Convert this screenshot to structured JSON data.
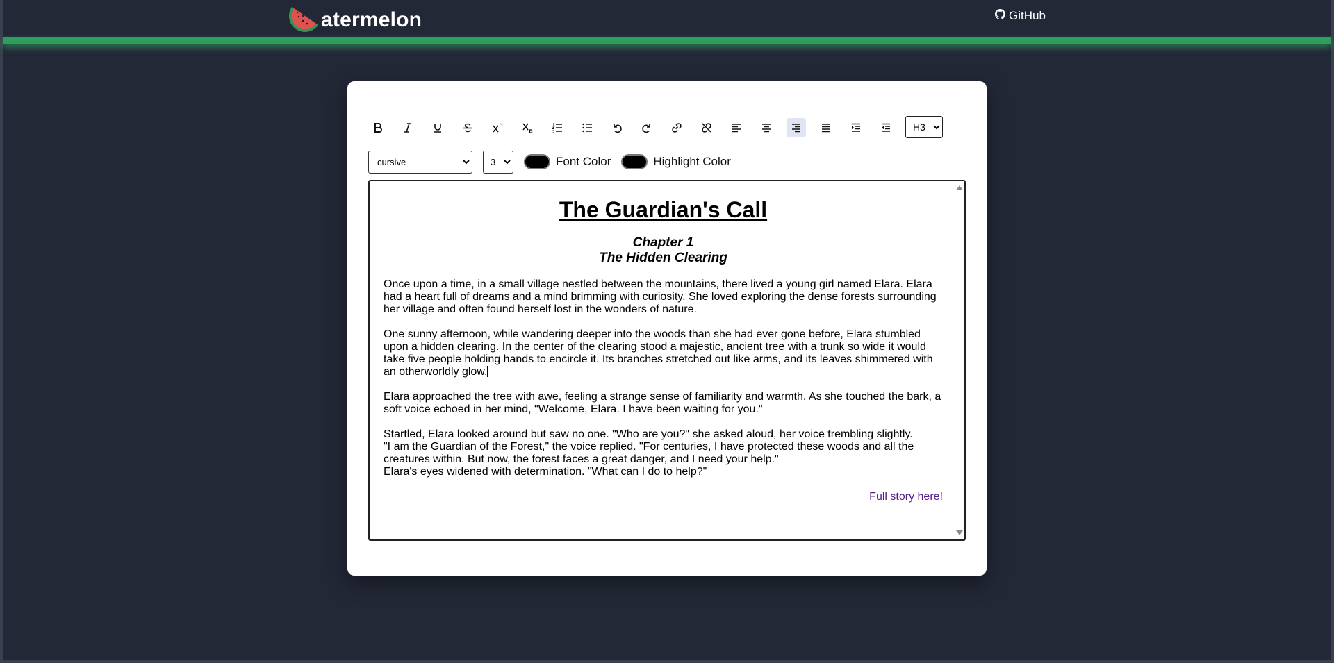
{
  "header": {
    "logo_text": "atermelon",
    "github_label": "GitHub"
  },
  "toolbar": {
    "buttons": [
      {
        "name": "bold-button",
        "icon": "bold-icon"
      },
      {
        "name": "italic-button",
        "icon": "italic-icon"
      },
      {
        "name": "underline-button",
        "icon": "underline-icon"
      },
      {
        "name": "strikethrough-button",
        "icon": "strikethrough-icon"
      },
      {
        "name": "superscript-button",
        "icon": "superscript-icon"
      },
      {
        "name": "subscript-button",
        "icon": "subscript-icon"
      },
      {
        "name": "ordered-list-button",
        "icon": "ordered-list-icon"
      },
      {
        "name": "unordered-list-button",
        "icon": "unordered-list-icon"
      },
      {
        "name": "undo-button",
        "icon": "undo-icon"
      },
      {
        "name": "redo-button",
        "icon": "redo-icon"
      },
      {
        "name": "link-button",
        "icon": "link-icon"
      },
      {
        "name": "unlink-button",
        "icon": "unlink-icon"
      },
      {
        "name": "align-left-button",
        "icon": "align-left-icon"
      },
      {
        "name": "align-center-button",
        "icon": "align-center-icon"
      },
      {
        "name": "align-right-button",
        "icon": "align-right-icon",
        "active": true
      },
      {
        "name": "align-justify-button",
        "icon": "align-justify-icon"
      },
      {
        "name": "indent-button",
        "icon": "indent-icon"
      },
      {
        "name": "outdent-button",
        "icon": "outdent-icon"
      }
    ],
    "heading_value": "H3",
    "font_family_value": "cursive",
    "font_size_value": "3",
    "font_color_label": "Font Color",
    "highlight_color_label": "Highlight Color",
    "font_color": "#000000",
    "highlight_color": "#000000"
  },
  "editor": {
    "title": "The Guardian's Call",
    "chapter_line1": "Chapter 1",
    "chapter_line2": "The Hidden Clearing",
    "para1": "Once upon a time, in a small village nestled between the mountains, there lived a young girl named Elara. Elara had a heart full of dreams and a mind brimming with curiosity. She loved exploring the dense forests surrounding her village and often found herself lost in the wonders of nature.",
    "para2": "One sunny afternoon, while wandering deeper into the woods than she had ever gone before, Elara stumbled upon a hidden clearing. In the center of the clearing stood a majestic, ancient tree with a trunk so wide it would take five people holding hands to encircle it. Its branches stretched out like arms, and its leaves shimmered with an otherworldly glow.",
    "para3": "Elara approached the tree with awe, feeling a strange sense of familiarity and warmth. As she touched the bark, a soft voice echoed in her mind, \"Welcome, Elara. I have been waiting for you.\"",
    "para4_line1": "Startled, Elara looked around but saw no one. \"Who are you?\" she asked aloud, her voice trembling slightly.",
    "para4_line2": "\"I am the Guardian of the Forest,\" the voice replied. \"For centuries, I have protected these woods and all the creatures within. But now, the forest faces a great danger, and I need your help.\"",
    "para4_line3": "Elara's eyes widened with determination. \"What can I do to help?\"",
    "link_text": "Full story here",
    "link_suffix": "!"
  },
  "colors": {
    "background": "#232837",
    "accent_green": "#2f9e5c",
    "watermelon_red": "#e0524f"
  }
}
